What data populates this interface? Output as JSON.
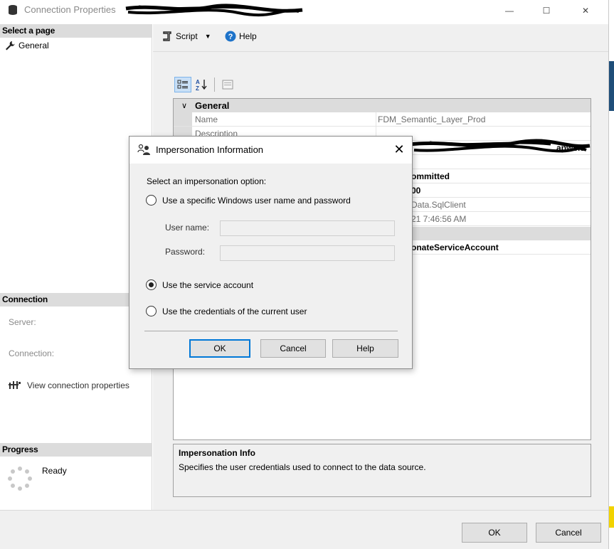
{
  "window": {
    "title": "Connection Properties",
    "controls": {
      "minimize": "—",
      "maximize": "☐",
      "close": "✕"
    }
  },
  "left_pane": {
    "select_page_header": "Select a page",
    "pages": [
      {
        "label": "General",
        "icon": "wrench-icon"
      }
    ],
    "connection_header": "Connection",
    "server_label": "Server:",
    "connection_label": "Connection:",
    "view_connection_link": "View connection properties",
    "progress_header": "Progress",
    "progress_status": "Ready"
  },
  "toolbar": {
    "script_label": "Script",
    "help_label": "Help"
  },
  "property_grid": {
    "category": "General",
    "rows": [
      {
        "name": "Name",
        "value": "FDM_Semantic_Layer_Prod"
      },
      {
        "name": "Description",
        "value": ""
      }
    ],
    "partial_values": {
      "isolation": "ommitted",
      "timeout": "00",
      "provider": "Data.SqlClient",
      "created": "21 7:46:56 AM",
      "impersonation": "onateServiceAccount",
      "connection_string_tail": "apws.s"
    }
  },
  "description_panel": {
    "title": "Impersonation Info",
    "text": "Specifies the user credentials used to connect to the data source."
  },
  "footer": {
    "ok_label": "OK",
    "cancel_label": "Cancel"
  },
  "dialog": {
    "title": "Impersonation Information",
    "close_glyph": "✕",
    "prompt": "Select an impersonation option:",
    "options": [
      {
        "label": "Use a specific Windows user name and password",
        "selected": false
      },
      {
        "label": "Use the service account",
        "selected": true
      },
      {
        "label": "Use the credentials of the current user",
        "selected": false
      }
    ],
    "user_name_label": "User name:",
    "user_name_value": "",
    "password_label": "Password:",
    "password_value": "",
    "ok_label": "OK",
    "cancel_label": "Cancel",
    "help_label": "Help"
  },
  "colors": {
    "section_header_bg": "#dcdcdc",
    "dialog_bg": "#f0f0f0",
    "default_button_border": "#0078d7",
    "help_icon_blue": "#1e73c9"
  }
}
